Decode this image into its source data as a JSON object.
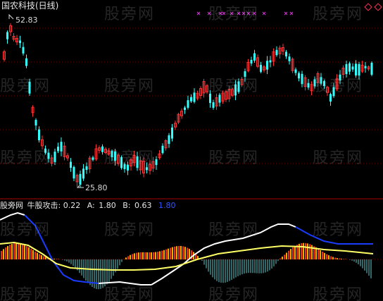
{
  "title": "国农科技(日线)",
  "price_high_label": "52.83",
  "price_low_label": "25.80",
  "indicator": {
    "source": "股旁网",
    "name": "牛股攻击:",
    "value": "0.22",
    "a_label": "A:",
    "a_value": "1.80",
    "b_label": "B:",
    "b_value": "0.63",
    "extra_value": "1.80"
  },
  "watermark": "股旁网",
  "colors": {
    "up": "#ff3333",
    "down": "#33ffff",
    "grid": "#7a0000",
    "line_white": "#ffffff",
    "line_blue": "#1a3cff",
    "line_yellow": "#ffff66",
    "marker": "#cc33cc",
    "bar_orange": "#ffaa00",
    "bar_down": "#66cccc"
  }
}
